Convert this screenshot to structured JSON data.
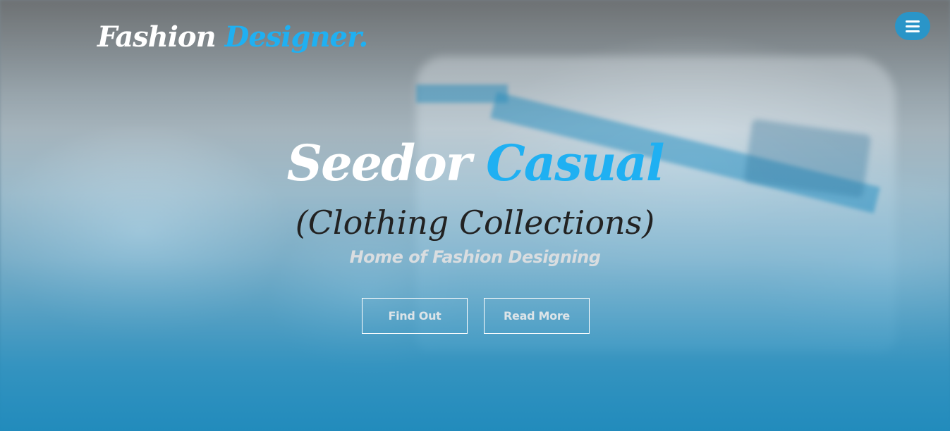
{
  "header": {
    "logo_part1": "Fashion",
    "logo_part2": "Designer.",
    "menu_icon": "hamburger-menu-icon"
  },
  "hero": {
    "title_part1": "Seedor",
    "title_part2": "Casual",
    "subtitle": "(Clothing Collections)",
    "tagline": "Home of Fashion Designing",
    "find_out_label": "Find Out",
    "read_more_label": "Read More"
  },
  "colors": {
    "accent": "#1fb0f2",
    "overlay_blue": "#1e8abc",
    "menu_button": "#2a95c8"
  }
}
